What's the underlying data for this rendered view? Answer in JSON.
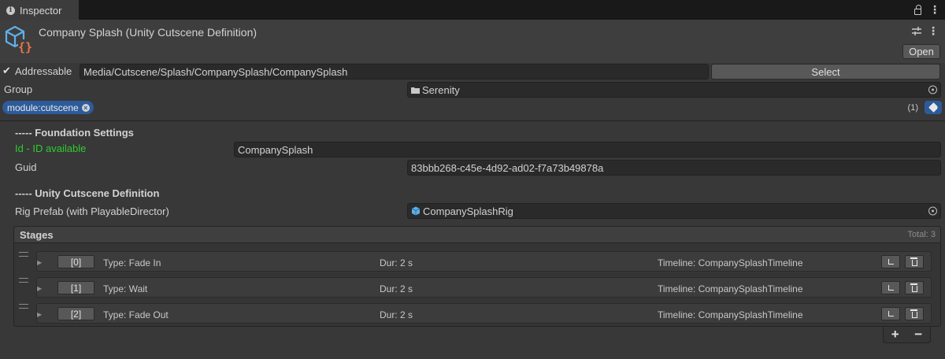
{
  "tab": {
    "title": "Inspector"
  },
  "header": {
    "title": "Company Splash (Unity Cutscene Definition)",
    "open_label": "Open",
    "icon": "cube-script-icon"
  },
  "addressable": {
    "checked": true,
    "check_glyph": "✔",
    "label": "Addressable",
    "path": "Media/Cutscene/Splash/CompanySplash/CompanySplash",
    "select_label": "Select"
  },
  "group": {
    "label": "Group",
    "value": "Serenity",
    "icon": "folder-icon"
  },
  "labels": {
    "chip": "module:cutscene",
    "count": "(1)"
  },
  "foundation": {
    "header": "----- Foundation Settings",
    "id_label": "Id - ID available",
    "id_value": "CompanySplash",
    "guid_label": "Guid",
    "guid_value": "83bbb268-c45e-4d92-ad02-f7a73b49878a"
  },
  "cutscene": {
    "header": "----- Unity Cutscene Definition",
    "rig_label": "Rig Prefab (with PlayableDirector)",
    "rig_value": "CompanySplashRig"
  },
  "stages": {
    "title": "Stages",
    "total": "Total: 3",
    "items": [
      {
        "index": "[0]",
        "type": "Type: Fade In",
        "dur": "Dur: 2 s",
        "timeline": "Timeline: CompanySplashTimeline"
      },
      {
        "index": "[1]",
        "type": "Type: Wait",
        "dur": "Dur: 2 s",
        "timeline": "Timeline: CompanySplashTimeline"
      },
      {
        "index": "[2]",
        "type": "Type: Fade Out",
        "dur": "Dur: 2 s",
        "timeline": "Timeline: CompanySplashTimeline"
      }
    ],
    "add_label": "+",
    "remove_label": "−"
  },
  "colors": {
    "accent_blue": "#2d5b9a",
    "green_status": "#2fcb2f",
    "background": "#383838"
  }
}
